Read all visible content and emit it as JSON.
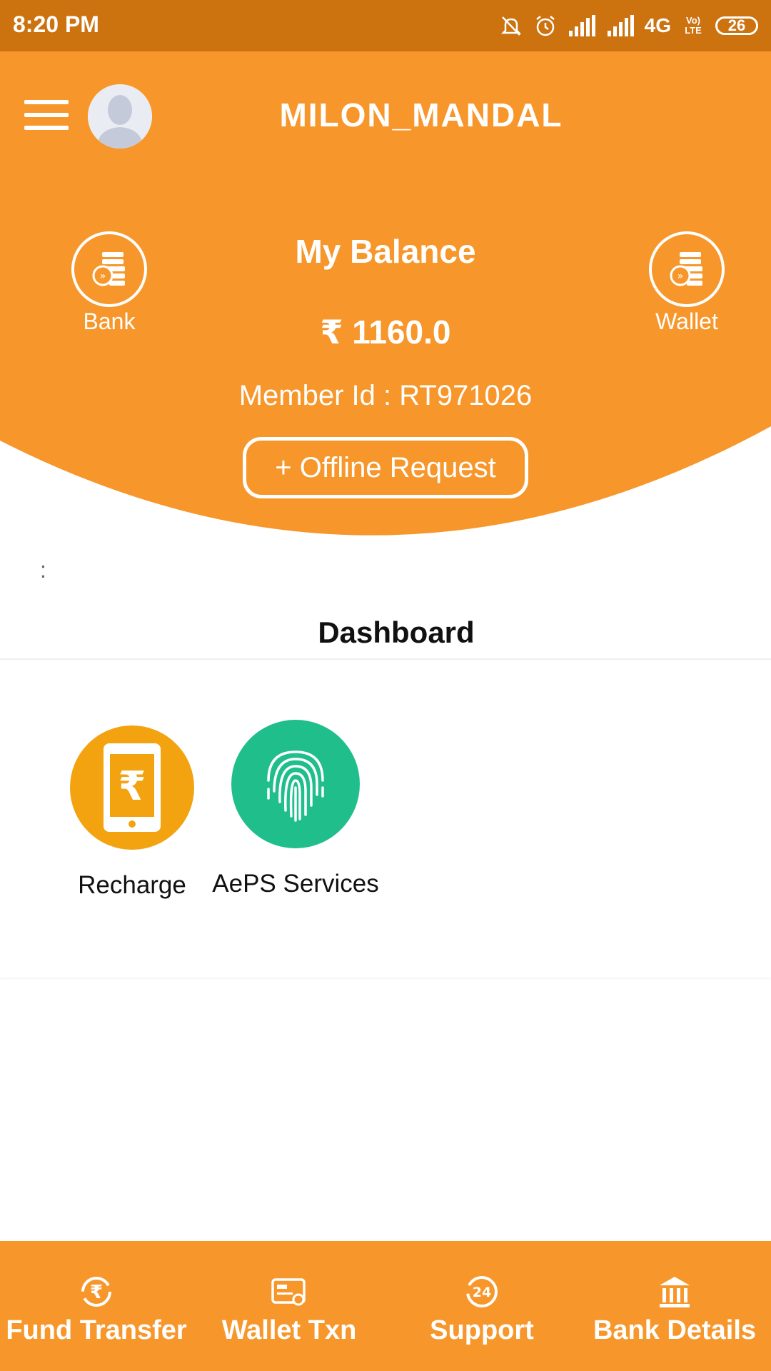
{
  "status_bar": {
    "time": "8:20 PM",
    "network": "4G",
    "volte": "Vo) LTE",
    "battery": "26"
  },
  "header": {
    "username": "MILON_MANDAL"
  },
  "balance": {
    "title": "My Balance",
    "amount": "₹  1160.0",
    "member_id": "Member Id  : RT971026",
    "offline_request": "+ Offline Request",
    "bank_label": "Bank",
    "wallet_label": "Wallet"
  },
  "dots": ":",
  "dashboard": {
    "title": "Dashboard",
    "services": [
      {
        "label": "Recharge",
        "icon": "mobile-rupee-icon",
        "color": "#F2A30F"
      },
      {
        "label": "AePS Services",
        "icon": "fingerprint-icon",
        "color": "#1FBE8A"
      }
    ]
  },
  "bottom_nav": [
    {
      "label": "Fund Transfer",
      "icon": "fund-transfer-icon"
    },
    {
      "label": "Wallet Txn",
      "icon": "wallet-txn-icon"
    },
    {
      "label": "Support",
      "icon": "support-24-icon"
    },
    {
      "label": "Bank Details",
      "icon": "bank-icon"
    }
  ],
  "colors": {
    "primary": "#F7972B",
    "status_bar": "#CC720F"
  }
}
